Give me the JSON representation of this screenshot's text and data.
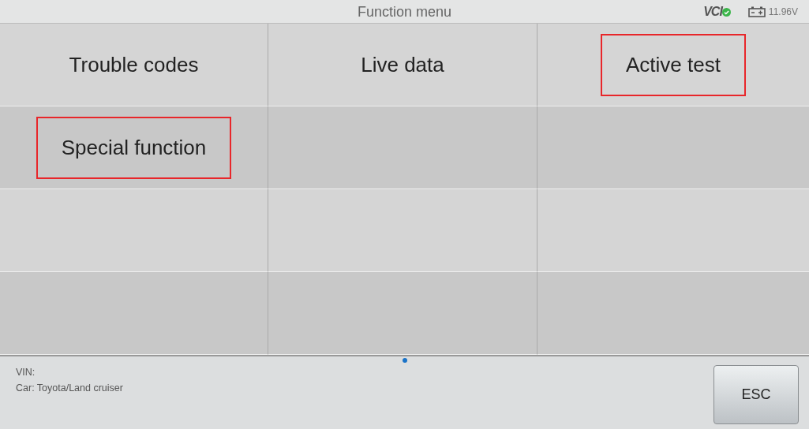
{
  "window": {
    "title": "Function menu"
  },
  "status": {
    "vci_label": "VCI",
    "vci_connected": true,
    "voltage": "11.96V"
  },
  "grid": {
    "rows": [
      [
        {
          "label": "Trouble codes",
          "highlighted": false
        },
        {
          "label": "Live data",
          "highlighted": false
        },
        {
          "label": "Active test",
          "highlighted": true
        }
      ],
      [
        {
          "label": "Special function",
          "highlighted": true
        },
        {
          "highlighted": false
        },
        {
          "highlighted": false
        }
      ],
      [
        {
          "highlighted": false
        },
        {
          "highlighted": false
        },
        {
          "highlighted": false
        }
      ],
      [
        {
          "highlighted": false
        },
        {
          "highlighted": false
        },
        {
          "highlighted": false
        }
      ]
    ]
  },
  "footer": {
    "vin": "VIN:",
    "car": "Car: Toyota/Land cruiser",
    "button": "ESC"
  }
}
